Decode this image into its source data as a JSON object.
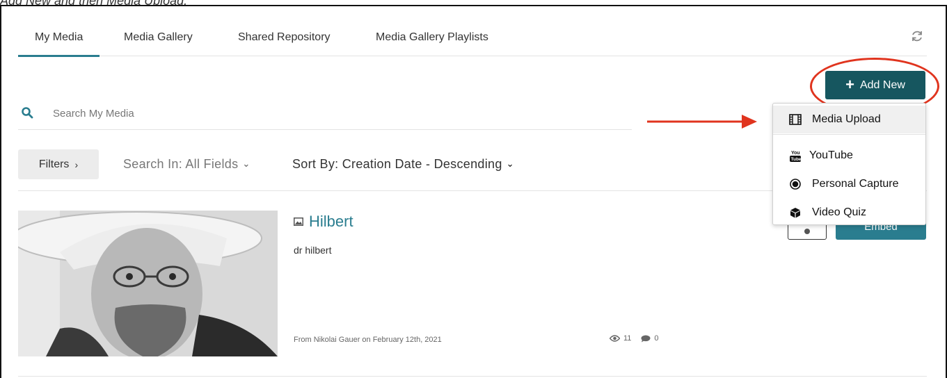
{
  "caption": "Add New and then Media Upload.",
  "tabs": [
    {
      "label": "My Media"
    },
    {
      "label": "Media Gallery"
    },
    {
      "label": "Shared Repository"
    },
    {
      "label": "Media Gallery Playlists"
    }
  ],
  "add_new": {
    "label": "Add New"
  },
  "search": {
    "placeholder": "Search My Media"
  },
  "filters": {
    "filters_label": "Filters",
    "search_in": "Search In: All Fields",
    "sort_by": "Sort By: Creation Date - Descending"
  },
  "entry": {
    "title": "Hilbert",
    "description": "dr hilbert",
    "meta": "From Nikolai Gauer on February 12th, 2021",
    "views": "11",
    "comments": "0",
    "embed_label": "Embed"
  },
  "dropdown": {
    "items": [
      {
        "label": "Media Upload",
        "icon": "film-icon"
      },
      {
        "label": "YouTube",
        "icon": "youtube-icon"
      },
      {
        "label": "Personal Capture",
        "icon": "record-icon"
      },
      {
        "label": "Video Quiz",
        "icon": "cube-icon"
      }
    ]
  },
  "colors": {
    "accent": "#2a7d8f",
    "button_dark": "#16565f",
    "annotation_red": "#e0341e"
  }
}
